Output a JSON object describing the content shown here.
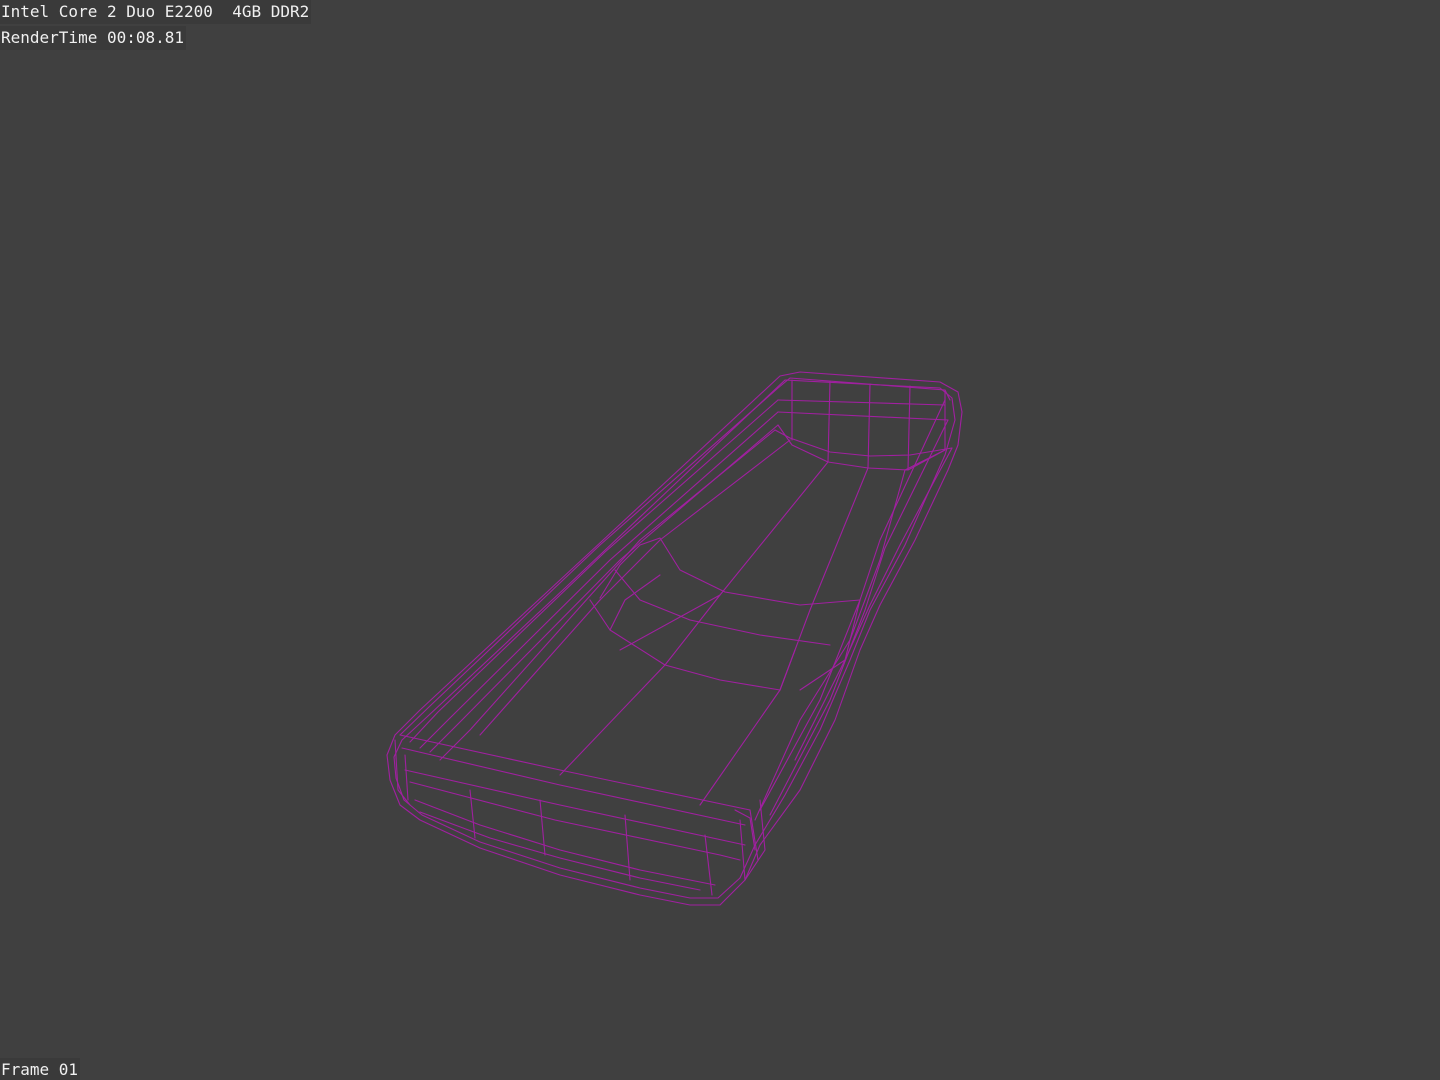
{
  "overlay": {
    "hardware": "Intel Core 2 Duo E2200  4GB DDR2",
    "render_time": "RenderTime 00:08.81",
    "frame": "Frame 01"
  },
  "viewport": {
    "background_color": "#404040",
    "wireframe_color": "#a020a0",
    "label_background": "#3a3a3a",
    "label_text_color": "#f0f0f0"
  }
}
